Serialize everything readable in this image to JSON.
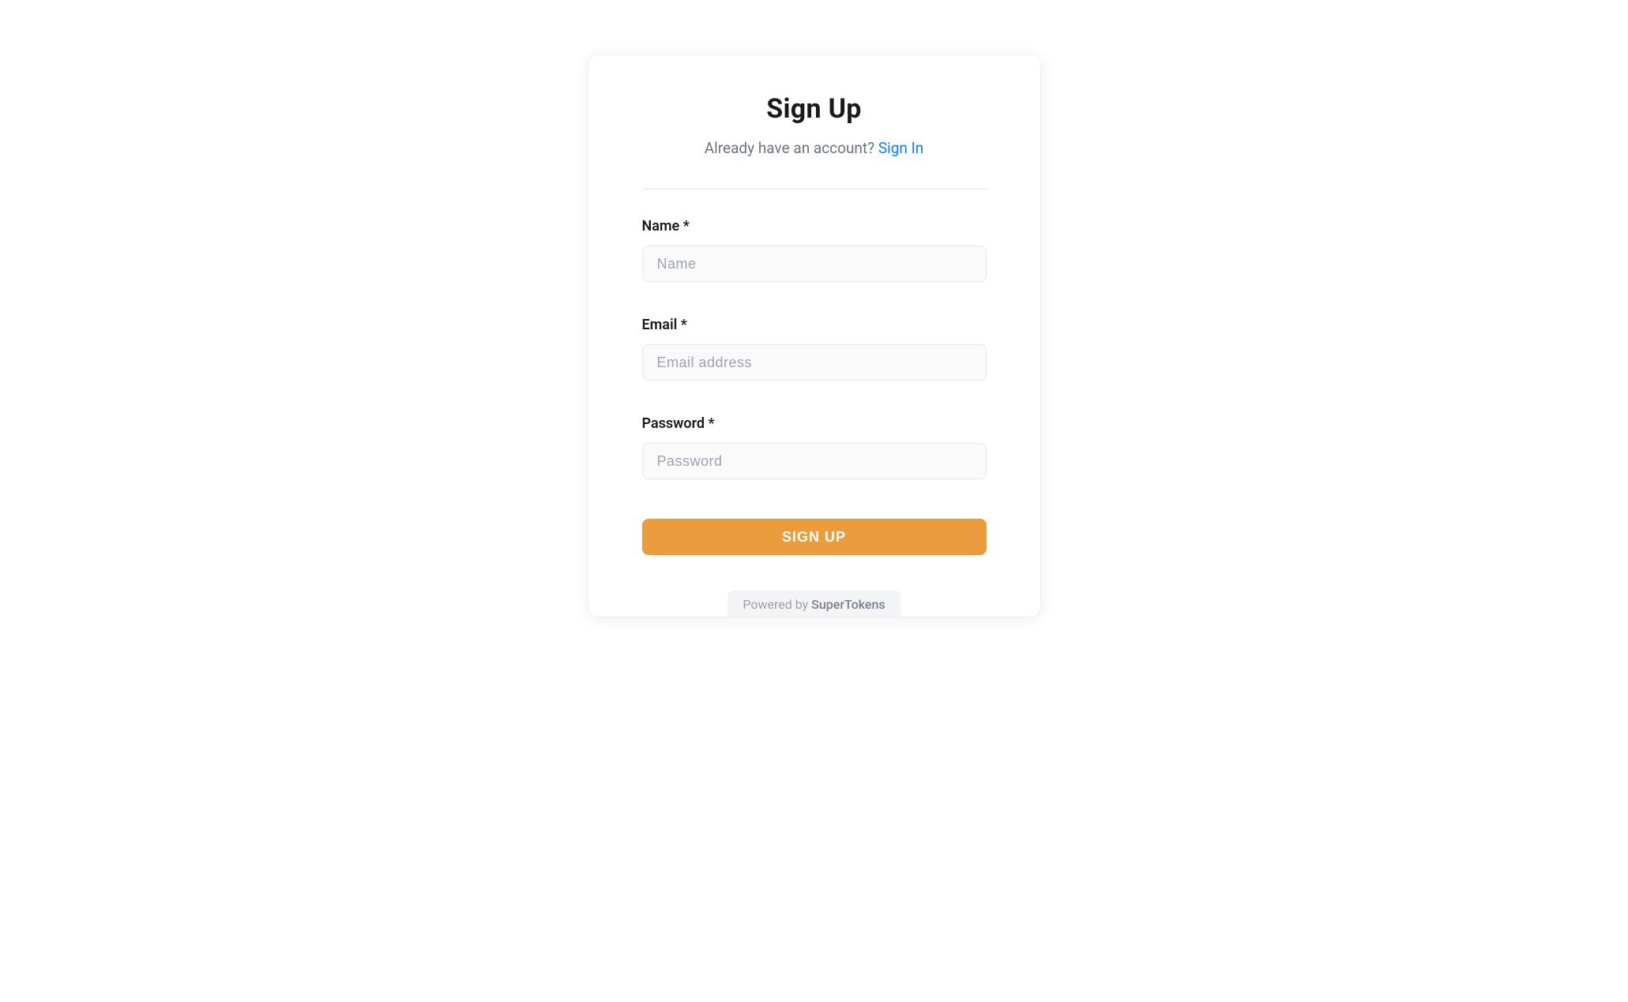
{
  "header": {
    "title": "Sign Up",
    "subtitle_text": "Already have an account? ",
    "signin_link": "Sign In"
  },
  "form": {
    "fields": [
      {
        "label": "Name *",
        "placeholder": "Name"
      },
      {
        "label": "Email *",
        "placeholder": "Email address"
      },
      {
        "label": "Password *",
        "placeholder": "Password"
      }
    ],
    "submit_label": "SIGN UP"
  },
  "footer": {
    "powered_by": "Powered by ",
    "brand": "SuperTokens"
  }
}
